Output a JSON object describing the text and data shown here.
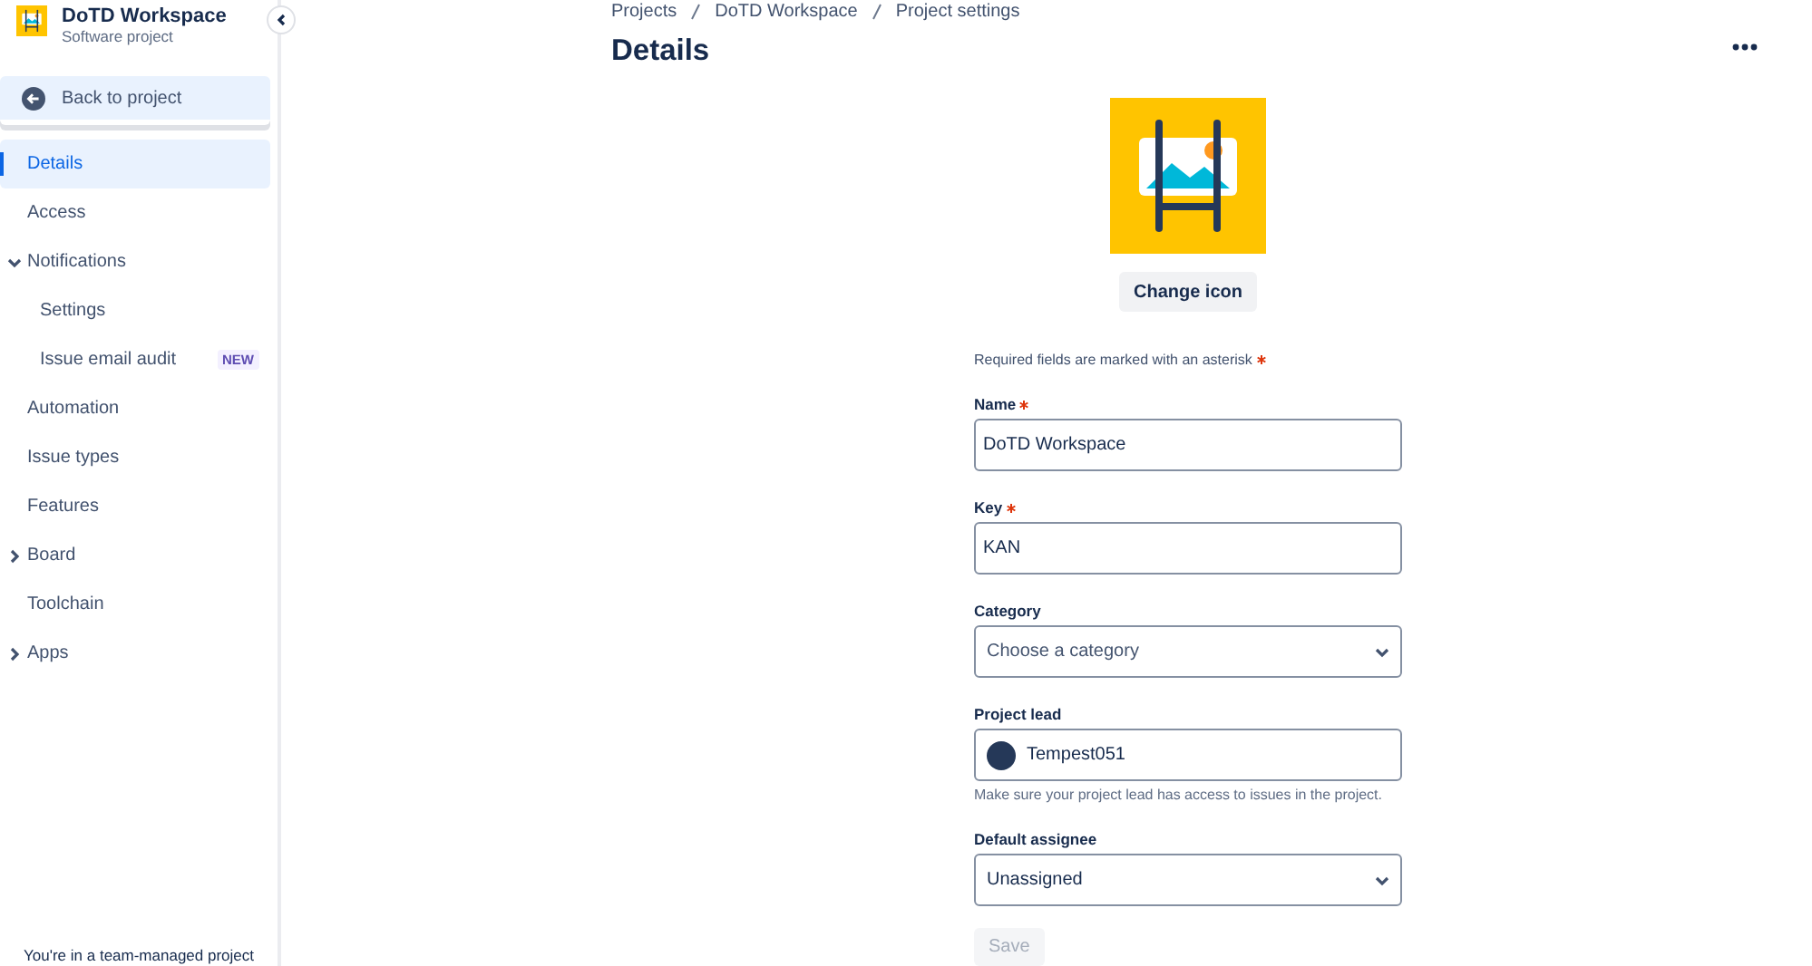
{
  "project": {
    "name": "DoTD Workspace",
    "type": "Software project"
  },
  "back_button": {
    "label": "Back to project"
  },
  "sidebar": {
    "items": [
      {
        "label": "Details",
        "selected": true
      },
      {
        "label": "Access",
        "selected": false
      },
      {
        "label": "Notifications",
        "selected": false,
        "expanded": true,
        "children": [
          {
            "label": "Settings",
            "selected": false
          },
          {
            "label": "Issue email audit",
            "selected": false,
            "badge": "NEW"
          }
        ]
      },
      {
        "label": "Automation",
        "selected": false
      },
      {
        "label": "Issue types",
        "selected": false
      },
      {
        "label": "Features",
        "selected": false
      },
      {
        "label": "Board",
        "selected": false,
        "expanded": false
      },
      {
        "label": "Toolchain",
        "selected": false
      },
      {
        "label": "Apps",
        "selected": false,
        "expanded": false
      }
    ],
    "footer": "You're in a team-managed project"
  },
  "breadcrumbs": [
    "Projects",
    "DoTD Workspace",
    "Project settings"
  ],
  "title": "Details",
  "change_icon_button": "Change icon",
  "required_note": "Required fields are marked with an asterisk",
  "fields": [
    {
      "kind": "text",
      "label": "Name",
      "required": true,
      "value": "DoTD Workspace"
    },
    {
      "kind": "text",
      "label": "Key",
      "required": true,
      "value": "KAN"
    },
    {
      "kind": "select",
      "label": "Category",
      "required": false,
      "placeholder": "Choose a category"
    },
    {
      "kind": "user",
      "label": "Project lead",
      "required": false,
      "value": "Tempest051",
      "help": "Make sure your project lead has access to issues in the project."
    },
    {
      "kind": "select",
      "label": "Default assignee",
      "required": false,
      "value": "Unassigned"
    }
  ],
  "save_button": {
    "label": "Save",
    "disabled": true
  }
}
